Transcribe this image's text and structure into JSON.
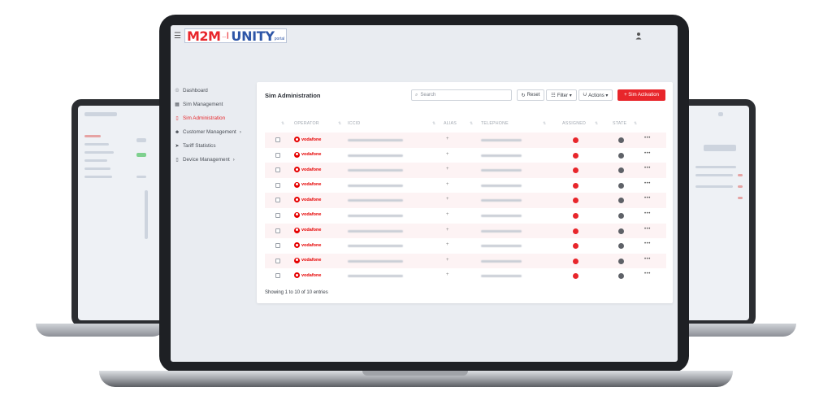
{
  "app": {
    "logo_m2m": "M2M",
    "logo_signal": "‥┃",
    "logo_unity": "UNITY",
    "logo_portal": "portal",
    "accent_color": "#e8262b",
    "brand_blue": "#2e56a7"
  },
  "sidebar": {
    "items": [
      {
        "icon": "dashboard-icon",
        "glyph": "☉",
        "label": "Dashboard",
        "active": false,
        "has_chevron": false
      },
      {
        "icon": "sim-grid-icon",
        "glyph": "▦",
        "label": "Sim Management",
        "active": false,
        "has_chevron": false
      },
      {
        "icon": "sim-card-icon",
        "glyph": "▯",
        "label": "Sim Administration",
        "active": true,
        "has_chevron": false
      },
      {
        "icon": "user-icon",
        "glyph": "☻",
        "label": "Customer Management",
        "active": false,
        "has_chevron": true,
        "chevron": "›"
      },
      {
        "icon": "send-icon",
        "glyph": "➤",
        "label": "Tariff Statistics",
        "active": false,
        "has_chevron": false
      },
      {
        "icon": "device-icon",
        "glyph": "▯",
        "label": "Device Management",
        "active": false,
        "has_chevron": true,
        "chevron": "›"
      }
    ]
  },
  "card": {
    "title": "Sim Administration",
    "search_placeholder": "Search",
    "search_icon": "⌕",
    "reset_icon": "↻",
    "reset_label": "Reset",
    "filter_icon": "☷",
    "filter_label": "Filter ▾",
    "actions_icon": "⮋",
    "actions_label": "Actions ▾",
    "activate_label": "+ Sim Activation"
  },
  "table": {
    "columns": {
      "operator": "OPERATOR",
      "iccid": "ICCID",
      "alias": "ALIAS",
      "telephone": "TELEPHONE",
      "assigned": "ASSIGNED",
      "state": "STATE"
    },
    "sort_glyph": "⇅",
    "rows": [
      {
        "operator": "vodafone",
        "alias": "+",
        "more": "•••"
      },
      {
        "operator": "vodafone",
        "alias": "+",
        "more": "•••"
      },
      {
        "operator": "vodafone",
        "alias": "+",
        "more": "•••"
      },
      {
        "operator": "vodafone",
        "alias": "+",
        "more": "•••"
      },
      {
        "operator": "vodafone",
        "alias": "+",
        "more": "•••"
      },
      {
        "operator": "vodafone",
        "alias": "+",
        "more": "•••"
      },
      {
        "operator": "vodafone",
        "alias": "+",
        "more": "•••"
      },
      {
        "operator": "vodafone",
        "alias": "+",
        "more": "•••"
      },
      {
        "operator": "vodafone",
        "alias": "+",
        "more": "•••"
      },
      {
        "operator": "vodafone",
        "alias": "+",
        "more": "•••"
      }
    ],
    "footer": "Showing 1 to 10 of 10 entries"
  }
}
